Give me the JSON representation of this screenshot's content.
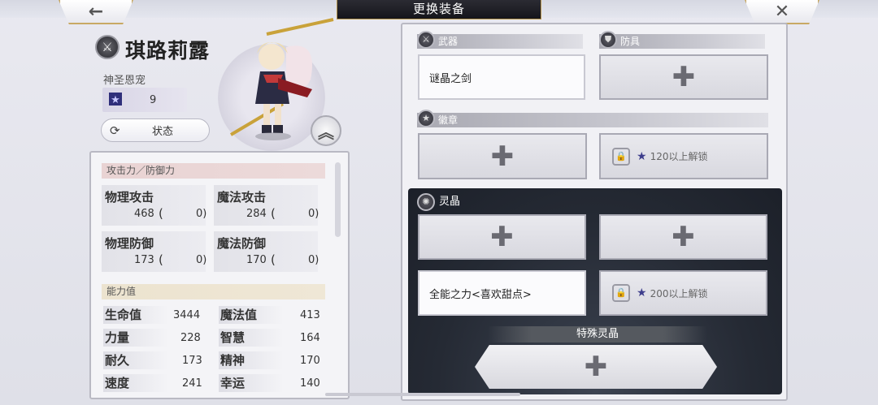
{
  "header": {
    "title": "更换装备",
    "back_icon": "←",
    "close_icon": "✕"
  },
  "character": {
    "name": "琪路莉露",
    "emblem_icon": "⚔",
    "title": "神圣恩宠",
    "rank_icon": "☆",
    "rank_glyph": "★",
    "rank_value": "9",
    "status_icon": "⟳",
    "status_label": "状态",
    "up_icon": "︽"
  },
  "stats": {
    "section1_title": "攻击力／防御力",
    "tiles": [
      {
        "name": "物理攻击",
        "value": "468",
        "paren_open": "(",
        "bonus": "0)"
      },
      {
        "name": "魔法攻击",
        "value": "284",
        "paren_open": "(",
        "bonus": "0)"
      },
      {
        "name": "物理防御",
        "value": "173",
        "paren_open": "(",
        "bonus": "0)"
      },
      {
        "name": "魔法防御",
        "value": "170",
        "paren_open": "(",
        "bonus": "0)"
      }
    ],
    "section2_title": "能力值",
    "abilities": [
      {
        "name": "生命值",
        "value": "3444",
        "name2": "魔法值",
        "value2": "413"
      },
      {
        "name": "力量",
        "value": "228",
        "name2": "智慧",
        "value2": "164"
      },
      {
        "name": "耐久",
        "value": "173",
        "name2": "精神",
        "value2": "170"
      },
      {
        "name": "速度",
        "value": "241",
        "name2": "幸运",
        "value2": "140"
      }
    ]
  },
  "equipment": {
    "weapon_label": "武器",
    "weapon_icon": "⚔",
    "weapon_slot": "谜晶之剑",
    "armor_label": "防具",
    "armor_icon": "⛊",
    "badge_label": "徽章",
    "badge_icon": "★",
    "badge_locked_text": "120以上解锁",
    "crystal_label": "灵晶",
    "crystal_icon": "✺",
    "crystal_slot_filled": "全能之力<喜欢甜点>",
    "crystal_locked_text": "200以上解锁",
    "special_label": "特殊灵晶",
    "plus": "✚",
    "lock_icon": "🔒",
    "lock_star": "★"
  }
}
